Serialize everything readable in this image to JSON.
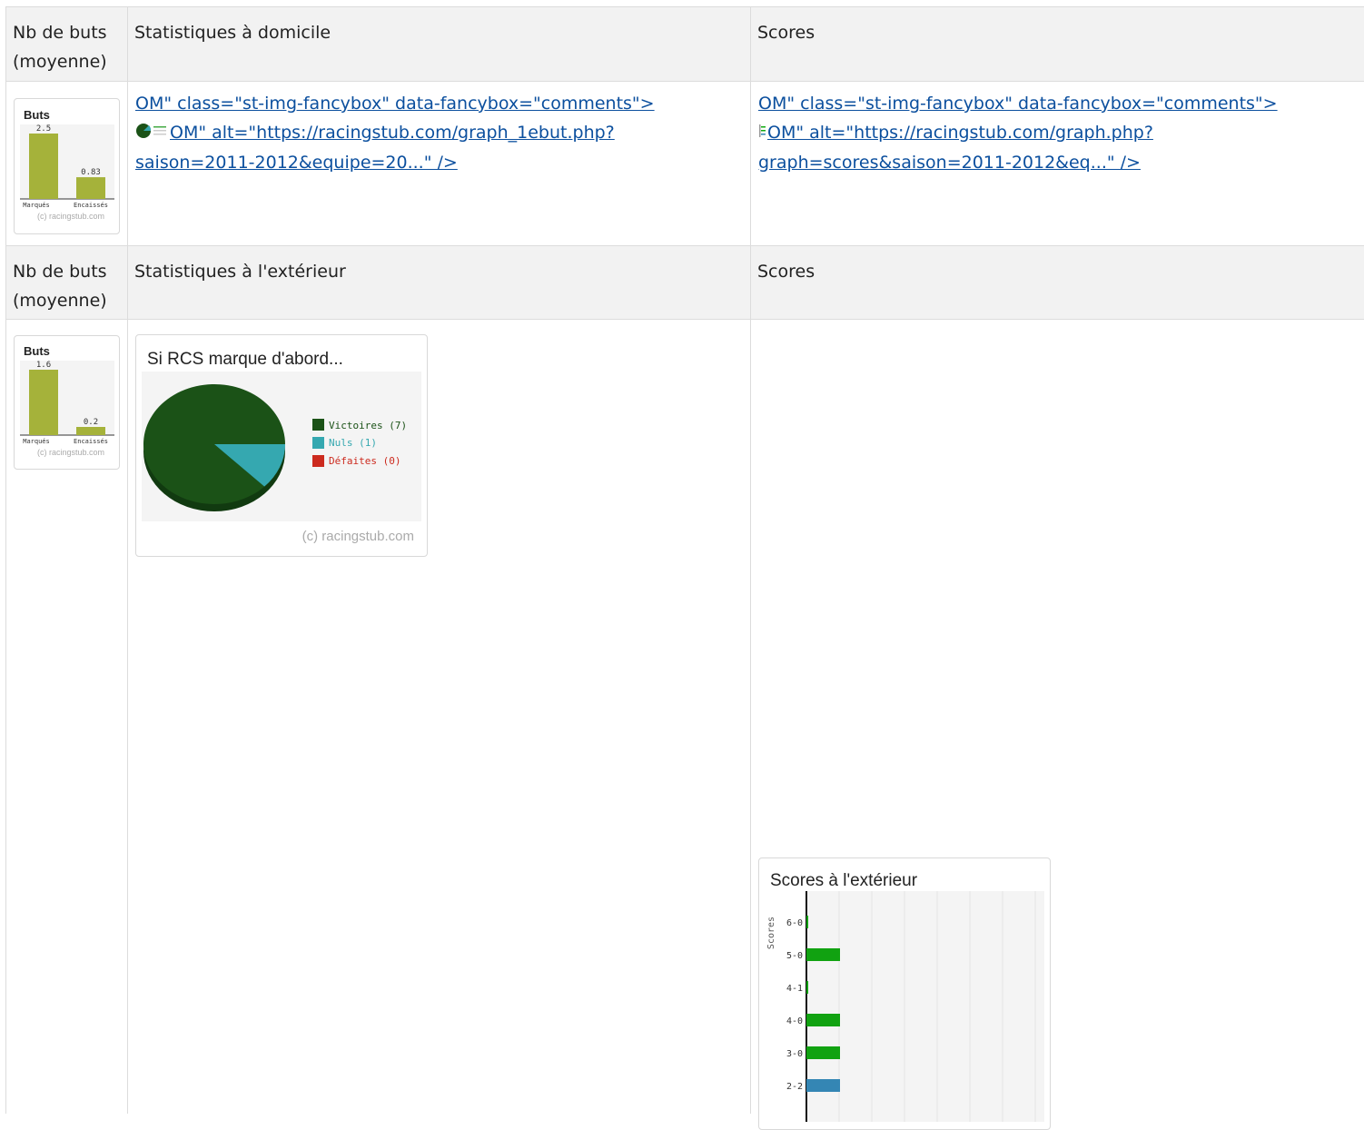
{
  "table": {
    "home_header": {
      "goals_label": "Nb de buts\n(moyenne)",
      "stats_label": "Statistiques à domicile",
      "scores_label": "Scores"
    },
    "home_row": {
      "buts_chart": {
        "title": "Buts",
        "bars": [
          {
            "label": "Marqués",
            "value": "2.5",
            "num": 2.5
          },
          {
            "label": "Encaissés",
            "value": "0.83",
            "num": 0.83
          }
        ],
        "credit": "(c) racingstub.com"
      },
      "stats_link": {
        "line1": "OM\" class=\"st-img-fancybox\" data-fancybox=\"comments\">",
        "line2": "OM\" alt=\"https://racingstub.com/graph_1ebut.php?",
        "line3": "saison=2011-2012&equipe=20...\" />"
      },
      "scores_link": {
        "line1": "OM\" class=\"st-img-fancybox\" data-fancybox=\"comments\">",
        "line2": "OM\" alt=\"https://racingstub.com/graph.php?",
        "line3": "graph=scores&saison=2011-2012&eq...\" />"
      }
    },
    "away_header": {
      "goals_label": "Nb de buts\n(moyenne)",
      "stats_label": "Statistiques à l'extérieur",
      "scores_label": "Scores"
    },
    "away_row": {
      "buts_chart": {
        "title": "Buts",
        "bars": [
          {
            "label": "Marqués",
            "value": "1.6",
            "num": 1.6
          },
          {
            "label": "Encaissés",
            "value": "0.2",
            "num": 0.2
          }
        ],
        "credit": "(c) racingstub.com"
      },
      "pie_chart": {
        "title": "Si RCS marque d'abord...",
        "legend": [
          {
            "label": "Victoires (7)",
            "value": 7,
            "color": "#1b5217"
          },
          {
            "label": "Nuls (1)",
            "value": 1,
            "color": "#35a8b0"
          },
          {
            "label": "Défaites (0)",
            "value": 0,
            "color": "#cc2a1e"
          }
        ],
        "credit": "(c) racingstub.com"
      },
      "scores_chart": {
        "title": "Scores à l'extérieur",
        "axis_label": "Scores",
        "bars": [
          {
            "label": "6-0",
            "value": 0.05,
            "color": "#11a211"
          },
          {
            "label": "5-0",
            "value": 1,
            "color": "#11a211"
          },
          {
            "label": "4-1",
            "value": 0.05,
            "color": "#11a211"
          },
          {
            "label": "4-0",
            "value": 1,
            "color": "#11a211"
          },
          {
            "label": "3-0",
            "value": 1,
            "color": "#11a211"
          },
          {
            "label": "2-2",
            "value": 1,
            "color": "#3486b4"
          }
        ]
      }
    }
  }
}
